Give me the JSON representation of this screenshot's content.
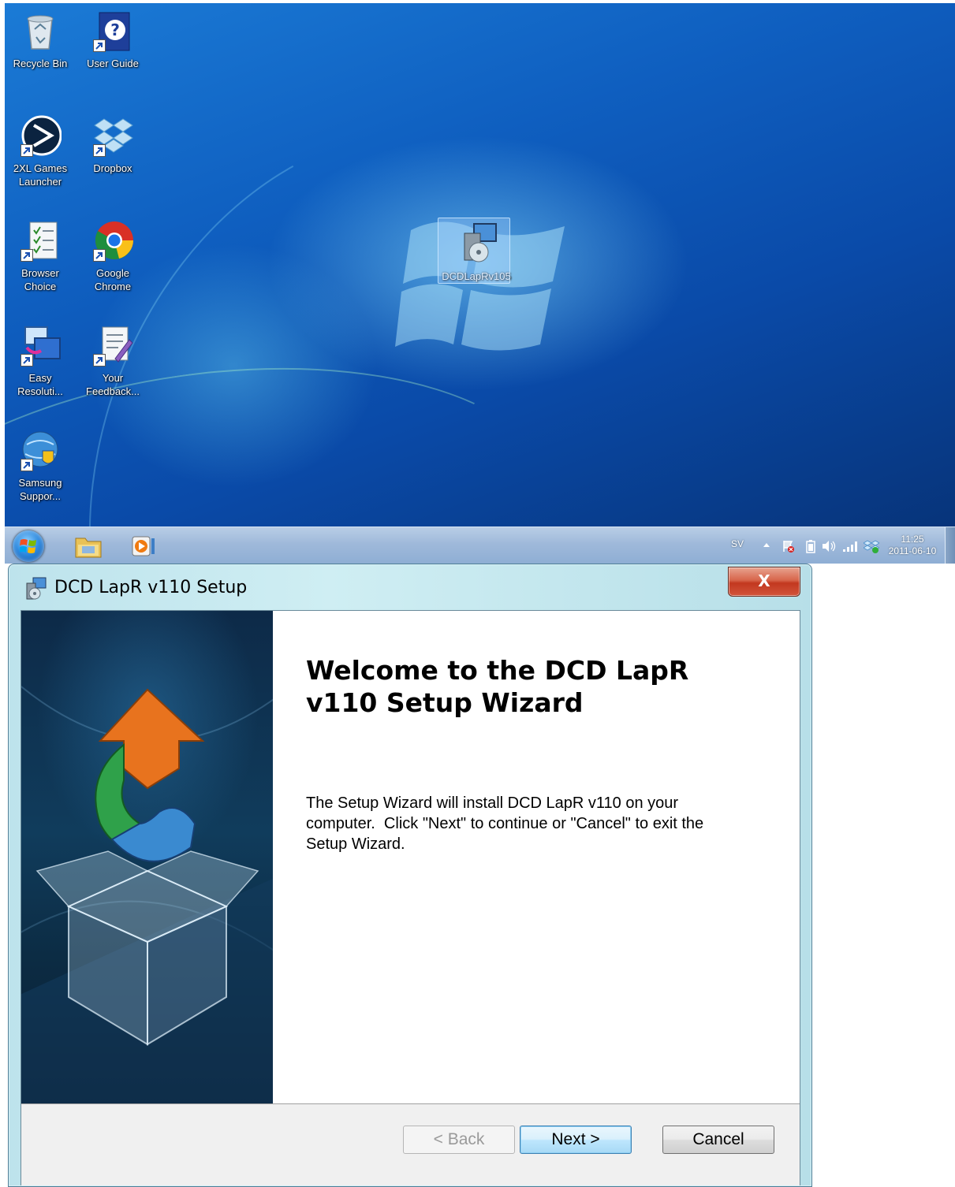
{
  "desktop": {
    "icons": [
      {
        "label": "Recycle Bin",
        "icon": "recycle-bin-icon"
      },
      {
        "label": "User Guide",
        "icon": "help-icon"
      },
      {
        "label": "2XL Games Launcher",
        "icon": "launcher-icon"
      },
      {
        "label": "Dropbox",
        "icon": "dropbox-icon"
      },
      {
        "label": "Browser Choice",
        "icon": "browser-choice-icon"
      },
      {
        "label": "Google Chrome",
        "icon": "chrome-icon"
      },
      {
        "label": "Easy Resoluti...",
        "icon": "resolution-icon"
      },
      {
        "label": "Your Feedback...",
        "icon": "feedback-icon"
      },
      {
        "label": "Samsung Suppor...",
        "icon": "samsung-support-icon"
      },
      {
        "label": "DCDLapRv105",
        "icon": "installer-icon",
        "selected": true
      }
    ]
  },
  "taskbar": {
    "pinned": [
      "explorer-icon",
      "media-player-icon"
    ],
    "tray": {
      "language": "SV",
      "icons": [
        "show-hidden-icons-arrow",
        "action-center-flag-icon",
        "battery-icon",
        "volume-icon",
        "network-signal-icon",
        "dropbox-tray-icon"
      ]
    },
    "clock": {
      "time": "11:25",
      "date": "2011-06-10"
    }
  },
  "setup_window": {
    "title": "DCD LapR v110 Setup",
    "close_label": "X",
    "welcome_title": "Welcome to the DCD LapR v110 Setup Wizard",
    "welcome_text": "The Setup Wizard will install DCD LapR v110 on your\ncomputer.  Click \"Next\" to continue or \"Cancel\" to exit the\nSetup Wizard.",
    "buttons": {
      "back": "< Back",
      "next": "Next >",
      "cancel": "Cancel"
    },
    "back_enabled": false
  },
  "colors": {
    "desktop_top": "#1b7bd6",
    "desktop_bottom": "#07347a",
    "window_frame": "#bde3ec",
    "close_red": "#c2381f"
  }
}
